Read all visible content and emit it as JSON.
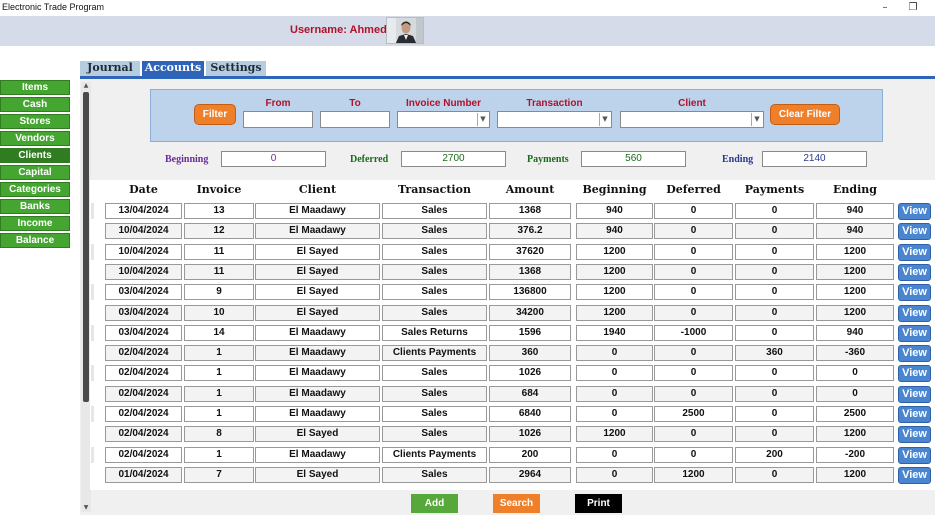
{
  "window": {
    "title": "Electronic Trade Program",
    "minimize": "–",
    "restore": "❐"
  },
  "header": {
    "username_label": "Username: Ahmed"
  },
  "sidebar": {
    "items": [
      {
        "label": "Items"
      },
      {
        "label": "Cash"
      },
      {
        "label": "Stores"
      },
      {
        "label": "Vendors"
      },
      {
        "label": "Clients"
      },
      {
        "label": "Capital"
      },
      {
        "label": "Categories"
      },
      {
        "label": "Banks"
      },
      {
        "label": "Income"
      },
      {
        "label": "Balance"
      }
    ],
    "active": 4
  },
  "tabs": [
    {
      "label": "Journal"
    },
    {
      "label": "Accounts"
    },
    {
      "label": "Settings"
    }
  ],
  "active_tab": 1,
  "filter": {
    "filter_button": "Filter",
    "clear_button": "Clear Filter",
    "from_label": "From",
    "from_value": "",
    "to_label": "To",
    "to_value": "",
    "invoice_label": "Invoice Number",
    "invoice_value": "",
    "transaction_label": "Transaction",
    "transaction_value": "",
    "client_label": "Client",
    "client_value": ""
  },
  "summary": {
    "beginning_label": "Beginning",
    "beginning_value": "0",
    "deferred_label": "Deferred",
    "deferred_value": "2700",
    "payments_label": "Payments",
    "payments_value": "560",
    "ending_label": "Ending",
    "ending_value": "2140"
  },
  "colors": {
    "beginning": "#6a2b9c",
    "deferred": "#1c6a1c",
    "payments": "#1c6a1c",
    "ending": "#2a3a8c",
    "view_button": "#4a86d0",
    "add_button": "#56a83a",
    "search_button": "#f07f2a",
    "print_button": "#000000"
  },
  "table": {
    "columns": [
      "Date",
      "Invoice",
      "Client",
      "Transaction",
      "Amount",
      "Beginning",
      "Deferred",
      "Payments",
      "Ending"
    ],
    "view_label": "View",
    "rows": [
      [
        "13/04/2024",
        "13",
        "El Maadawy",
        "Sales",
        "1368",
        "940",
        "0",
        "0",
        "940"
      ],
      [
        "10/04/2024",
        "12",
        "El Maadawy",
        "Sales",
        "376.2",
        "940",
        "0",
        "0",
        "940"
      ],
      [
        "10/04/2024",
        "11",
        "El Sayed",
        "Sales",
        "37620",
        "1200",
        "0",
        "0",
        "1200"
      ],
      [
        "10/04/2024",
        "11",
        "El Sayed",
        "Sales",
        "1368",
        "1200",
        "0",
        "0",
        "1200"
      ],
      [
        "03/04/2024",
        "9",
        "El Sayed",
        "Sales",
        "136800",
        "1200",
        "0",
        "0",
        "1200"
      ],
      [
        "03/04/2024",
        "10",
        "El Sayed",
        "Sales",
        "34200",
        "1200",
        "0",
        "0",
        "1200"
      ],
      [
        "03/04/2024",
        "14",
        "El Maadawy",
        "Sales Returns",
        "1596",
        "1940",
        "-1000",
        "0",
        "940"
      ],
      [
        "02/04/2024",
        "1",
        "El Maadawy",
        "Clients Payments",
        "360",
        "0",
        "0",
        "360",
        "-360"
      ],
      [
        "02/04/2024",
        "1",
        "El Maadawy",
        "Sales",
        "1026",
        "0",
        "0",
        "0",
        "0"
      ],
      [
        "02/04/2024",
        "1",
        "El Maadawy",
        "Sales",
        "684",
        "0",
        "0",
        "0",
        "0"
      ],
      [
        "02/04/2024",
        "1",
        "El Maadawy",
        "Sales",
        "6840",
        "0",
        "2500",
        "0",
        "2500"
      ],
      [
        "02/04/2024",
        "8",
        "El Sayed",
        "Sales",
        "1026",
        "1200",
        "0",
        "0",
        "1200"
      ],
      [
        "02/04/2024",
        "1",
        "El Maadawy",
        "Clients Payments",
        "200",
        "0",
        "0",
        "200",
        "-200"
      ],
      [
        "01/04/2024",
        "7",
        "El Sayed",
        "Sales",
        "2964",
        "0",
        "1200",
        "0",
        "1200"
      ]
    ]
  },
  "bottom": {
    "add": "Add",
    "search": "Search",
    "print": "Print"
  }
}
